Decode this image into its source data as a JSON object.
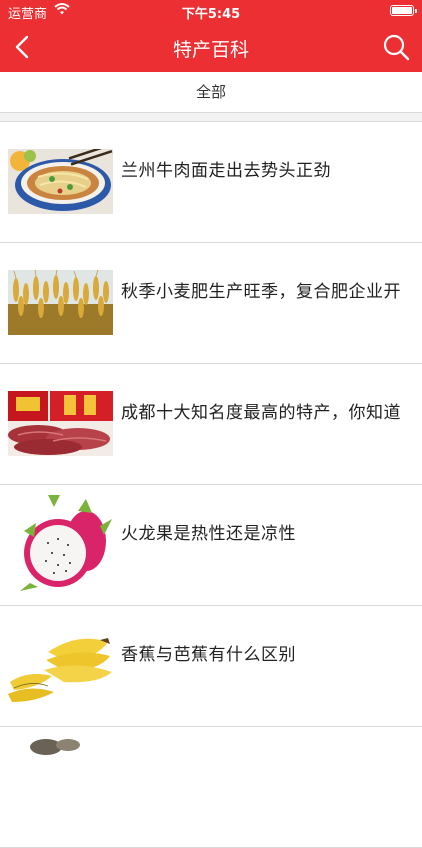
{
  "status": {
    "carrier": "运营商",
    "time": "下午5:45"
  },
  "nav": {
    "title": "特产百科",
    "back_icon": "chevron-left-icon",
    "search_icon": "search-icon"
  },
  "filter": {
    "label": "全部"
  },
  "articles": [
    {
      "title": "兰州牛肉面走出去势头正劲",
      "image": "beef-noodle-bowl"
    },
    {
      "title": "秋季小麦肥生产旺季，复合肥企业开",
      "image": "wheat-field"
    },
    {
      "title": "成都十大知名度最高的特产，你知道",
      "image": "dried-beef-package"
    },
    {
      "title": "火龙果是热性还是凉性",
      "image": "dragon-fruit"
    },
    {
      "title": "香蕉与芭蕉有什么区别",
      "image": "bananas"
    }
  ],
  "colors": {
    "brand": "#ec2f33",
    "divider": "#d9d9d9"
  }
}
